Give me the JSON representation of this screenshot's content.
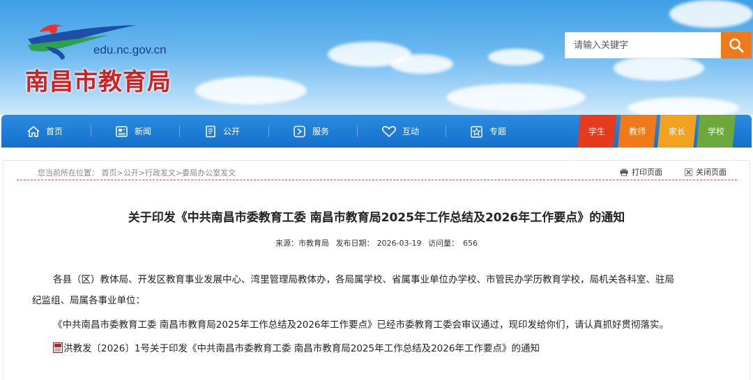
{
  "header": {
    "site_name": "南昌市教育局",
    "domain": "edu.nc.gov.cn",
    "search_placeholder": "请输入关键字"
  },
  "nav": {
    "items": [
      {
        "label": "首页",
        "icon": "home-icon"
      },
      {
        "label": "新闻",
        "icon": "newspaper-icon"
      },
      {
        "label": "公开",
        "icon": "document-icon"
      },
      {
        "label": "服务",
        "icon": "service-icon"
      },
      {
        "label": "互动",
        "icon": "heart-icon"
      },
      {
        "label": "专题",
        "icon": "star-icon"
      }
    ],
    "roles": [
      {
        "label": "学生",
        "color": "#e63a1e"
      },
      {
        "label": "教师",
        "color": "#f07a1a"
      },
      {
        "label": "家长",
        "color": "#f3a21f"
      },
      {
        "label": "学校",
        "color": "#6ea83a"
      }
    ]
  },
  "breadcrumb": {
    "prefix": "您当前所在位置：",
    "path": "首页>公开>行政发文>委局办公室发文"
  },
  "tools": {
    "print": "打印页面",
    "close": "关闭页面"
  },
  "article": {
    "title": "关于印发《中共南昌市委教育工委 南昌市教育局2025年工作总结及2026年工作要点》的通知",
    "source_label": "来源：",
    "source": "市教育局",
    "date_label": "发布日期：",
    "date": "2026-03-19",
    "views_label": "访问量：",
    "views": "656",
    "para1_line1": "各县（区）教体局、开发区教育事业发展中心、湾里管理局教体办，各局属学校、省属事业单位办学校、市管民办学历教育学校，局机关各科室、驻局",
    "para1_line2": "纪监组、局属各事业单位：",
    "para2": "《中共南昌市委教育工委 南昌市教育局2025年工作总结及2026年工作要点》已经市委教育工委会审议通过，现印发给你们，请认真抓好贯彻落实。",
    "attachment": "洪教发〔2026〕1号关于印发《中共南昌市委教育工委 南昌市教育局2025年工作总结及2026年工作要点》的通知"
  },
  "colors": {
    "nav_blue": "#1c7cd6",
    "search_orange": "#f07a1a",
    "title_red": "#d42020"
  }
}
